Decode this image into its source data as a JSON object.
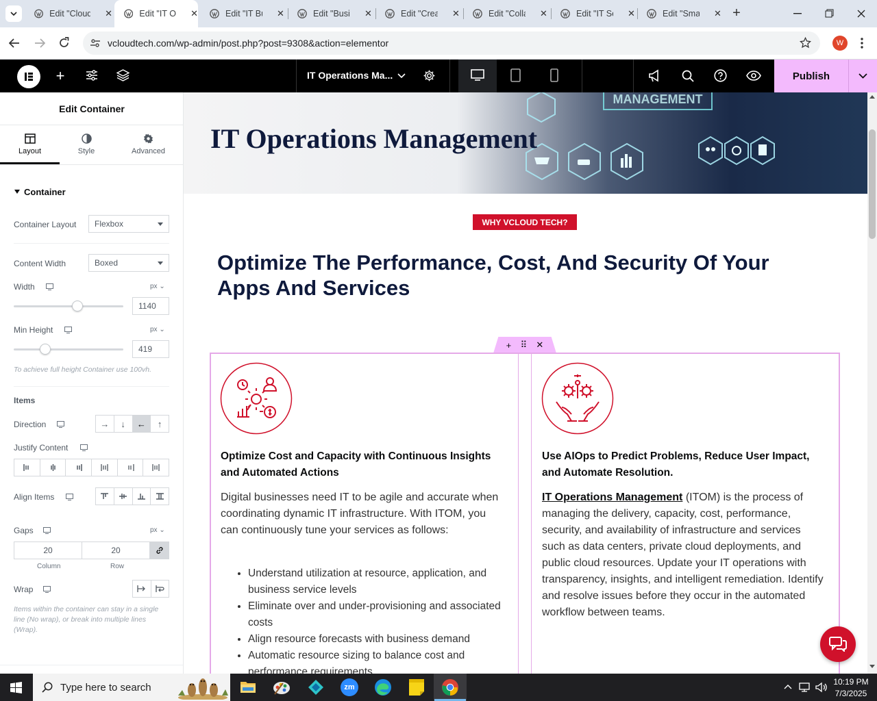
{
  "browser": {
    "tabs": [
      {
        "title": "Edit \"Cloud"
      },
      {
        "title": "Edit \"IT Op"
      },
      {
        "title": "Edit \"IT Bu"
      },
      {
        "title": "Edit \"Busin"
      },
      {
        "title": "Edit \"Creat"
      },
      {
        "title": "Edit \"Colla"
      },
      {
        "title": "Edit \"IT Se"
      },
      {
        "title": "Edit \"Smar"
      }
    ],
    "url": "vcloudtech.com/wp-admin/post.php?post=9308&action=elementor",
    "profile_initial": "W"
  },
  "editor": {
    "page_title": "IT Operations Ma...",
    "publish_label": "Publish"
  },
  "panel": {
    "title": "Edit Container",
    "tabs": [
      "Layout",
      "Style",
      "Advanced"
    ],
    "section": "Container",
    "container_layout": {
      "label": "Container Layout",
      "value": "Flexbox"
    },
    "content_width": {
      "label": "Content Width",
      "value": "Boxed"
    },
    "width": {
      "label": "Width",
      "unit": "px",
      "value": "1140"
    },
    "min_height": {
      "label": "Min Height",
      "unit": "px",
      "value": "419"
    },
    "min_height_hint": "To achieve full height Container use 100vh.",
    "items_heading": "Items",
    "direction_label": "Direction",
    "justify_label": "Justify Content",
    "align_label": "Align Items",
    "gaps": {
      "label": "Gaps",
      "unit": "px",
      "column": "20",
      "row": "20",
      "column_label": "Column",
      "row_label": "Row"
    },
    "wrap_label": "Wrap",
    "wrap_hint": "Items within the container can stay in a single line (No wrap), or break into multiple lines (Wrap)."
  },
  "page": {
    "hero_title": "IT Operations Management",
    "hero_bg_text": "MANAGEMENT",
    "badge": "WHY VCLOUD TECH?",
    "heading": "Optimize The Performance, Cost, And Security Of Your Apps And Services",
    "left_card": {
      "title": "Optimize Cost and Capacity with Continuous Insights and Automated Actions",
      "body": "Digital businesses need IT to be agile and accurate when coordinating dynamic IT infrastructure. With ITOM, you can continuously tune your services as follows:",
      "bullets": [
        "Understand utilization at resource, application, and business service levels",
        "Eliminate over and under-provisioning and associated costs",
        "Align resource forecasts with business demand",
        "Automatic resource sizing to balance cost and performance requirements"
      ]
    },
    "right_card": {
      "title": "Use AIOps to Predict Problems, Reduce User Impact, and Automate Resolution.",
      "link_text": "IT Operations Management",
      "body": " (ITOM) is the process of managing the delivery, capacity, cost, performance, security, and availability of infrastructure and services such as data centers, private cloud deployments, and public cloud resources. Update your IT operations with transparency, insights, and intelligent remediation. Identify and resolve issues before they occur in the automated workflow between teams."
    }
  },
  "taskbar": {
    "search_placeholder": "Type here to search",
    "time": "10:19 PM",
    "date": "7/3/2025"
  },
  "colors": {
    "accent_red": "#d0112b",
    "navy": "#0f1a3c",
    "publish_bg": "#f3bafd",
    "selection_pink": "#e5a9e8"
  }
}
